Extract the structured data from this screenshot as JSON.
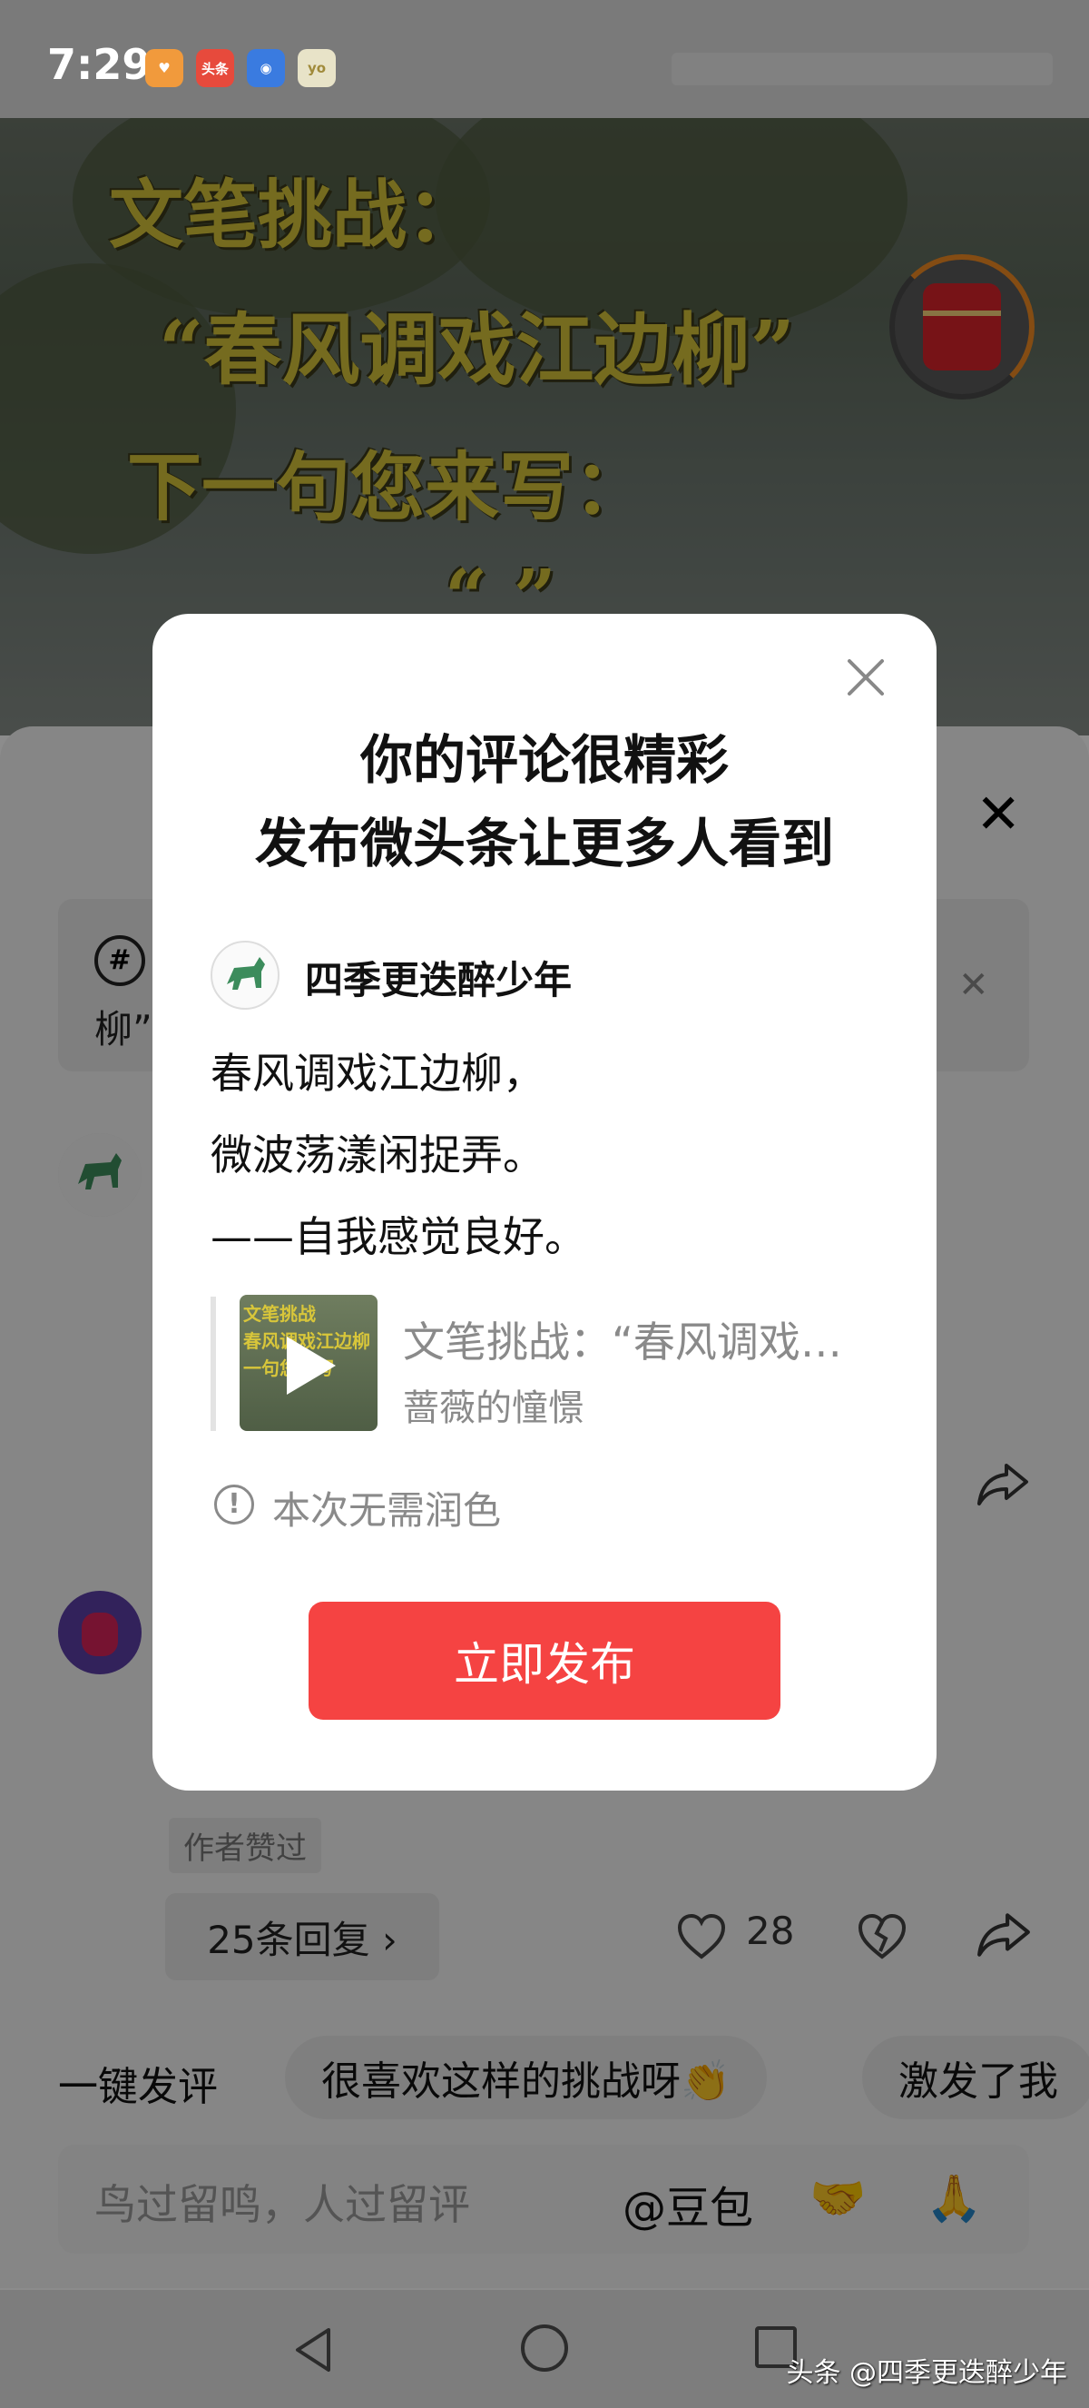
{
  "status_bar": {
    "time": "7:29",
    "apps": [
      "headline-app",
      "toutiao",
      "blue-app",
      "yoyo"
    ]
  },
  "video": {
    "line1": "文笔挑战：",
    "line2": "“春风调戏江边柳”",
    "line3": "下一句您来写：",
    "line4": "“            ”"
  },
  "background": {
    "topic_icon": "#",
    "topic_text": "柳”",
    "author_liked": "作者赞过",
    "replies": "25条回复 ›",
    "likes": "28",
    "quick_comment_label": "一键发评",
    "quick_chips": [
      "很喜欢这样的挑战呀👏",
      "激发了我"
    ],
    "input_placeholder": "鸟过留鸣，人过留评",
    "at_mention": "@豆包",
    "emoji1": "🤝",
    "emoji2": "🙏"
  },
  "dialog": {
    "title_line1": "你的评论很精彩",
    "title_line2": "发布微头条让更多人看到",
    "username": "四季更迭醉少年",
    "poem_line1": "春风调戏江边柳，",
    "poem_line2": "微波荡漾闲捉弄。",
    "poem_line3": "——自我感觉良好。",
    "quote_title": "文笔挑战：“春风调戏…",
    "quote_author": "蔷薇的憧憬",
    "thumb_text": "文笔挑战\n春风调戏江边柳\n一句您来写",
    "notice_icon": "!",
    "notice": "本次无需润色",
    "publish_button": "立即发布"
  },
  "watermark": "头条 @四季更迭醉少年",
  "colors": {
    "accent": "#f54342",
    "overlay": "rgba(0,0,0,0.45)"
  }
}
